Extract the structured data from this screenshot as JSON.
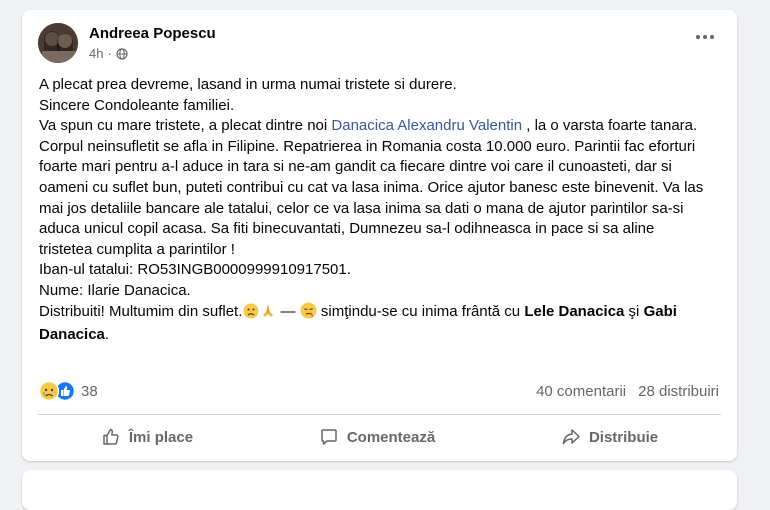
{
  "post": {
    "author": "Andreea Popescu",
    "time": "4h",
    "line1": "A plecat prea devreme, lasand in urma numai tristete si durere.",
    "line2": "Sincere Condoleante familiei.",
    "line3_pre": "Va spun cu mare tristete, a plecat dintre noi ",
    "line3_link": "Danacica Alexandru Valentin",
    "line3_post": " , la o varsta foarte tanara.",
    "paragraph": "Corpul neinsufletit se afla in Filipine. Repatrierea in Romania costa 10.000 euro. Parintii fac eforturi foarte mari pentru a-l aduce in tara si ne-am gandit ca fiecare dintre voi care il cunoasteti, dar si oameni cu suflet bun, puteti contribui cu cat va lasa inima. Orice ajutor banesc este binevenit. Va las mai jos detaliile bancare ale tatalui, celor ce va lasa inima sa dati o mana de ajutor parintilor sa-si aduca unicul copil acasa. Sa fiti binecuvantati, Dumnezeu sa-l odihneasca in pace si sa aline tristetea cumplita a parintilor !",
    "iban": "Iban-ul tatalui: RO53INGB0000999910917501.",
    "name": "Nume: Ilarie Danacica.",
    "final_pre": "Distribuiti! Multumim din suflet.",
    "final_dash": " — ",
    "feeling": " simţindu-se cu inima frântă cu ",
    "tag1": "Lele Danacica",
    "and": " şi ",
    "tag2": "Gabi Danacica",
    "period": "."
  },
  "reactions": {
    "count": "38"
  },
  "stats": {
    "comments": "40 comentarii",
    "shares": "28 distribuiri"
  },
  "actions": {
    "like": "Îmi place",
    "comment": "Comentează",
    "share": "Distribuie"
  }
}
